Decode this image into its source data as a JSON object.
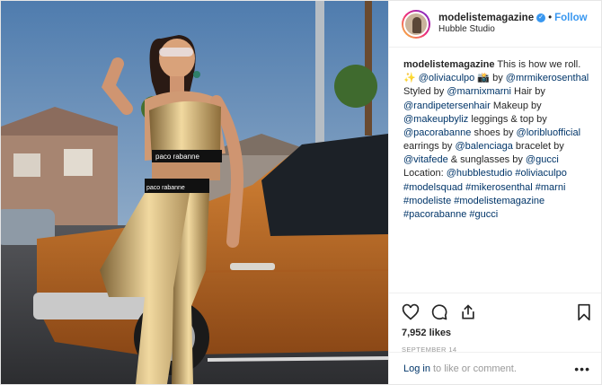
{
  "post": {
    "username": "modelistemagazine",
    "follow_label": "Follow",
    "separator": "•",
    "location": "Hubble Studio",
    "caption": {
      "author": "modelistemagazine",
      "parts": [
        {
          "t": "text",
          "v": " This is how we roll. ✨ "
        },
        {
          "t": "link",
          "v": "@oliviaculpo"
        },
        {
          "t": "text",
          "v": " 📸 by "
        },
        {
          "t": "link",
          "v": "@mrmikerosenthal"
        },
        {
          "t": "text",
          "v": " Styled by "
        },
        {
          "t": "link",
          "v": "@marnixmarni"
        },
        {
          "t": "text",
          "v": " Hair by "
        },
        {
          "t": "link",
          "v": "@randipetersenhair"
        },
        {
          "t": "text",
          "v": " Makeup by "
        },
        {
          "t": "link",
          "v": "@makeupbyliz"
        },
        {
          "t": "text",
          "v": " leggings & top by "
        },
        {
          "t": "link",
          "v": "@pacorabanne"
        },
        {
          "t": "text",
          "v": " shoes by "
        },
        {
          "t": "link",
          "v": "@loribluofficial"
        },
        {
          "t": "text",
          "v": " earrings by "
        },
        {
          "t": "link",
          "v": "@balenciaga"
        },
        {
          "t": "text",
          "v": " bracelet by "
        },
        {
          "t": "link",
          "v": "@vitafede"
        },
        {
          "t": "text",
          "v": " & sunglasses by "
        },
        {
          "t": "link",
          "v": "@gucci"
        },
        {
          "t": "text",
          "v": " Location: "
        },
        {
          "t": "link",
          "v": "@hubblestudio"
        },
        {
          "t": "text",
          "v": " "
        },
        {
          "t": "link",
          "v": "#oliviaculpo"
        },
        {
          "t": "text",
          "v": " "
        },
        {
          "t": "link",
          "v": "#modelsquad"
        },
        {
          "t": "text",
          "v": " "
        },
        {
          "t": "link",
          "v": "#mikerosenthal"
        },
        {
          "t": "text",
          "v": " "
        },
        {
          "t": "link",
          "v": "#marni"
        },
        {
          "t": "text",
          "v": " "
        },
        {
          "t": "link",
          "v": "#modeliste"
        },
        {
          "t": "text",
          "v": " "
        },
        {
          "t": "link",
          "v": "#modelistemagazine"
        },
        {
          "t": "text",
          "v": " "
        },
        {
          "t": "link",
          "v": "#pacorabanne"
        },
        {
          "t": "text",
          "v": " "
        },
        {
          "t": "link",
          "v": "#gucci"
        }
      ]
    },
    "likes": "7,952 likes",
    "date": "SEPTEMBER 14",
    "login_link": "Log in",
    "login_text": "to like or comment.",
    "more_label": "•••",
    "brand_text_top": "paco rabanne",
    "brand_text_waist": "paco rabanne"
  },
  "icons": {
    "like": "heart-icon",
    "comment": "comment-icon",
    "share": "share-icon",
    "save": "bookmark-icon",
    "verified": "verified-badge-icon"
  },
  "colors": {
    "link": "#003569",
    "follow": "#3897f0",
    "muted": "#999999",
    "car": "#c66f2a",
    "gold": "#c9a25d"
  }
}
